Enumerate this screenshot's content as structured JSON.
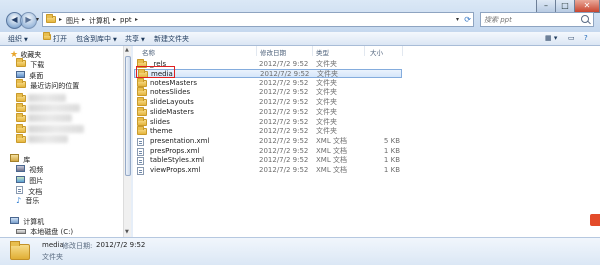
{
  "address": {
    "crumbs": [
      "图片",
      "计算机",
      "ppt"
    ]
  },
  "search": {
    "placeholder": "搜索 ppt"
  },
  "toolbar": {
    "organize": "组织",
    "open": "打开",
    "include_in_library": "包含到库中",
    "share": "共享",
    "new_folder": "新建文件夹"
  },
  "nav": {
    "favorites": "收藏夹",
    "downloads": "下载",
    "desktop": "桌面",
    "recent": "最近访问的位置",
    "libraries": "库",
    "videos": "视频",
    "pictures": "图片",
    "documents": "文档",
    "music": "音乐",
    "computer": "计算机",
    "local_disk": "本地磁盘 (C:)"
  },
  "columns": {
    "name": "名称",
    "modified": "修改日期",
    "type": "类型",
    "size": "大小"
  },
  "files": [
    {
      "name": "_rels",
      "modified": "2012/7/2 9:52",
      "type": "文件夹",
      "size": "",
      "icon": "folder-icon"
    },
    {
      "name": "media",
      "modified": "2012/7/2 9:52",
      "type": "文件夹",
      "size": "",
      "icon": "folder-icon"
    },
    {
      "name": "notesMasters",
      "modified": "2012/7/2 9:52",
      "type": "文件夹",
      "size": "",
      "icon": "folder-icon"
    },
    {
      "name": "notesSlides",
      "modified": "2012/7/2 9:52",
      "type": "文件夹",
      "size": "",
      "icon": "folder-icon"
    },
    {
      "name": "slideLayouts",
      "modified": "2012/7/2 9:52",
      "type": "文件夹",
      "size": "",
      "icon": "folder-icon"
    },
    {
      "name": "slideMasters",
      "modified": "2012/7/2 9:52",
      "type": "文件夹",
      "size": "",
      "icon": "folder-icon"
    },
    {
      "name": "slides",
      "modified": "2012/7/2 9:52",
      "type": "文件夹",
      "size": "",
      "icon": "folder-icon"
    },
    {
      "name": "theme",
      "modified": "2012/7/2 9:52",
      "type": "文件夹",
      "size": "",
      "icon": "folder-icon"
    },
    {
      "name": "presentation.xml",
      "modified": "2012/7/2 9:52",
      "type": "XML 文档",
      "size": "5 KB",
      "icon": "xml-file-icon"
    },
    {
      "name": "presProps.xml",
      "modified": "2012/7/2 9:52",
      "type": "XML 文档",
      "size": "1 KB",
      "icon": "xml-file-icon"
    },
    {
      "name": "tableStyles.xml",
      "modified": "2012/7/2 9:52",
      "type": "XML 文档",
      "size": "1 KB",
      "icon": "xml-file-icon"
    },
    {
      "name": "viewProps.xml",
      "modified": "2012/7/2 9:52",
      "type": "XML 文档",
      "size": "1 KB",
      "icon": "xml-file-icon"
    }
  ],
  "details": {
    "name": "media",
    "modified_label": "修改日期:",
    "modified_value": "2012/7/2 9:52",
    "type": "文件夹"
  },
  "colors": {
    "selection_border": "#84acdd",
    "highlight_box": "#e02020"
  }
}
